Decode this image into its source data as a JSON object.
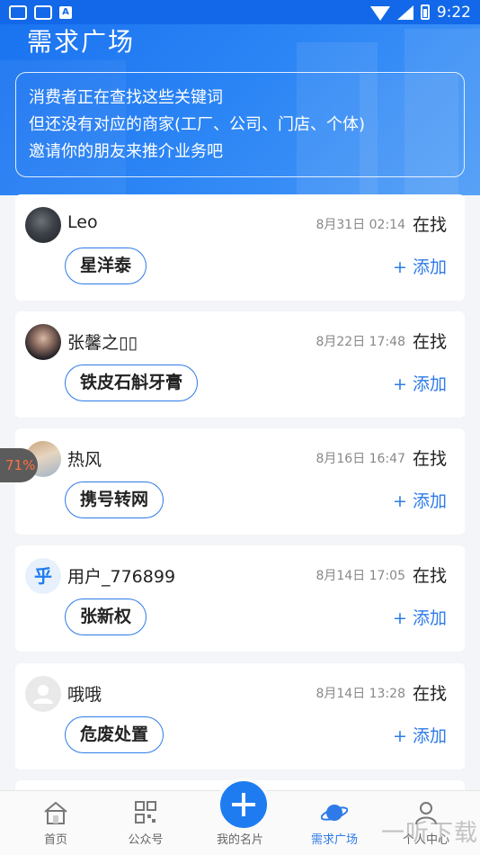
{
  "status_bar": {
    "time": "9:22"
  },
  "header": {
    "title": "需求广场",
    "notice_lines": [
      "消费者正在查找这些关键词",
      "但还没有对应的商家(工厂、公司、门店、个体)",
      "邀请你的朋友来推介业务吧"
    ]
  },
  "demands": [
    {
      "name": "Leo",
      "time": "8月31日 02:14",
      "action": "在找",
      "keyword": "星洋泰",
      "add_label": "+ 添加",
      "avatar": "dark-photo"
    },
    {
      "name": "张馨之▯▯",
      "time": "8月22日 17:48",
      "action": "在找",
      "keyword": "铁皮石斛牙膏",
      "add_label": "+ 添加",
      "avatar": "woman-photo"
    },
    {
      "name": "热风",
      "time": "8月16日 16:47",
      "action": "在找",
      "keyword": "携号转网",
      "add_label": "+ 添加",
      "avatar": "landscape-photo"
    },
    {
      "name": "用户_776899",
      "time": "8月14日 17:05",
      "action": "在找",
      "keyword": "张新权",
      "add_label": "+ 添加",
      "avatar": "zhihu-icon",
      "avatar_text": "乎"
    },
    {
      "name": "哦哦",
      "time": "8月14日 13:28",
      "action": "在找",
      "keyword": "危废处置",
      "add_label": "+ 添加",
      "avatar": "default-user-icon"
    }
  ],
  "float_badge": "71%",
  "bottom_nav": {
    "items": [
      {
        "label": "首页",
        "icon": "home-icon"
      },
      {
        "label": "公众号",
        "icon": "qrcode-icon"
      },
      {
        "label": "我的名片",
        "icon": "plus-icon"
      },
      {
        "label": "需求广场",
        "icon": "planet-icon",
        "active": true
      },
      {
        "label": "个人中心",
        "icon": "person-icon"
      }
    ]
  },
  "watermark": "一听下载",
  "colors": {
    "primary": "#1e7cf0",
    "accent": "#2e7be8",
    "background": "#f4f5f8"
  }
}
